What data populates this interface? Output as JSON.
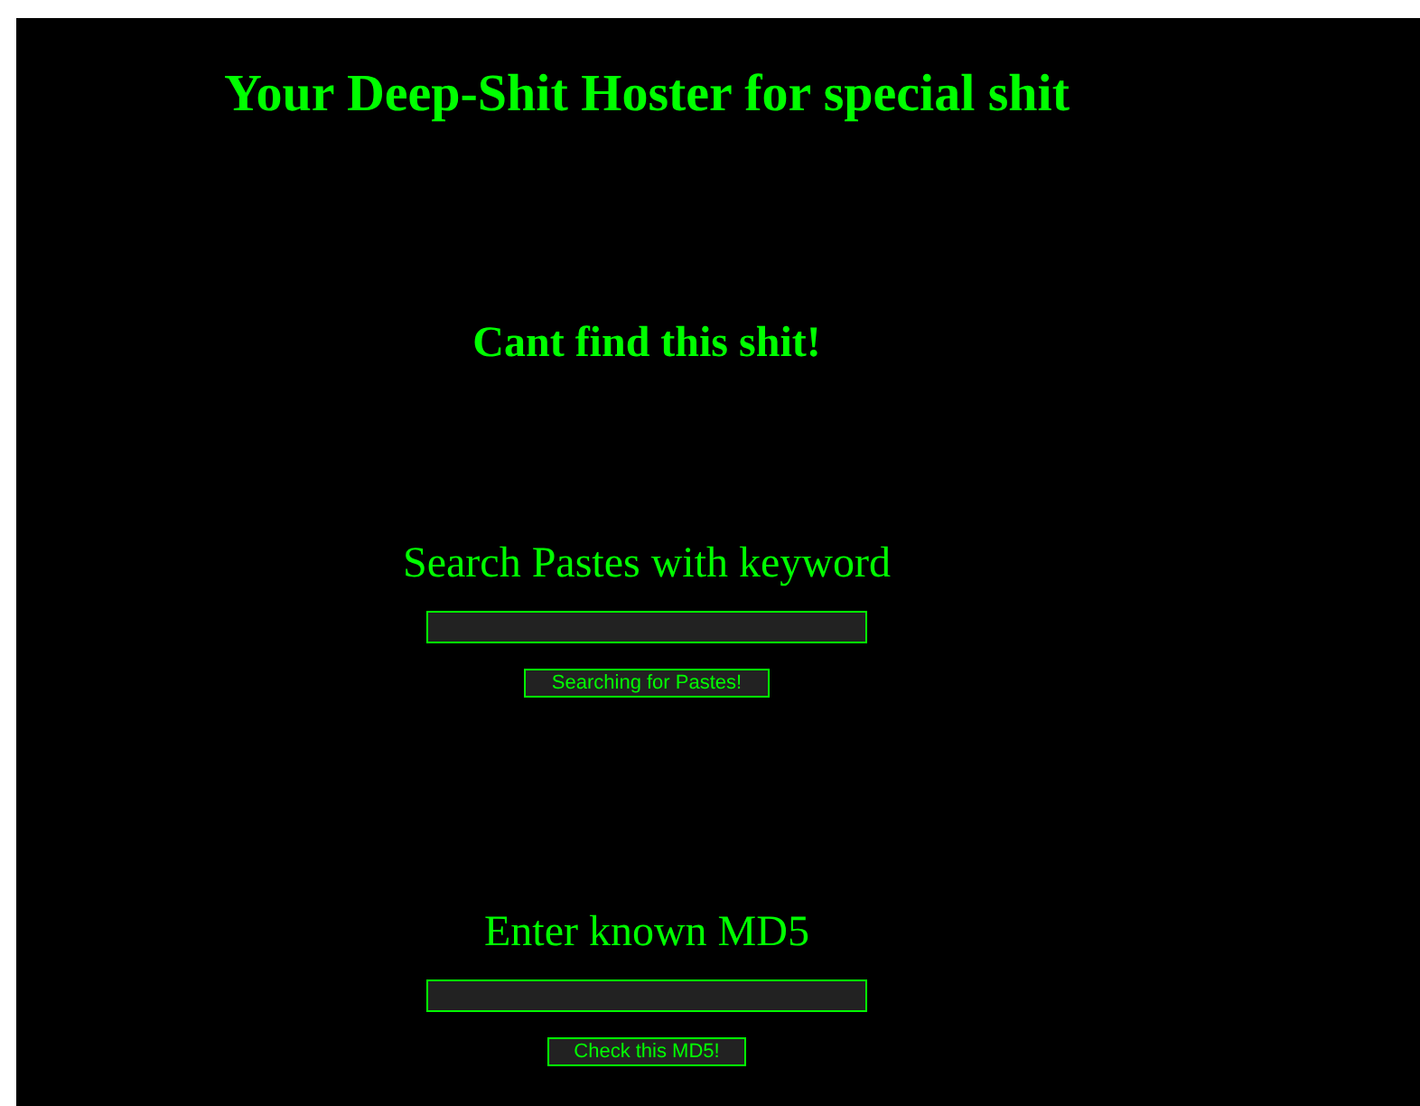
{
  "title": "Your Deep-Shit Hoster for special shit",
  "message": "Cant find this shit!",
  "forms": [
    {
      "heading": "Search Pastes with keyword",
      "button": "Searching for Pastes!"
    },
    {
      "heading": "Enter known MD5",
      "button": "Check this MD5!"
    }
  ]
}
